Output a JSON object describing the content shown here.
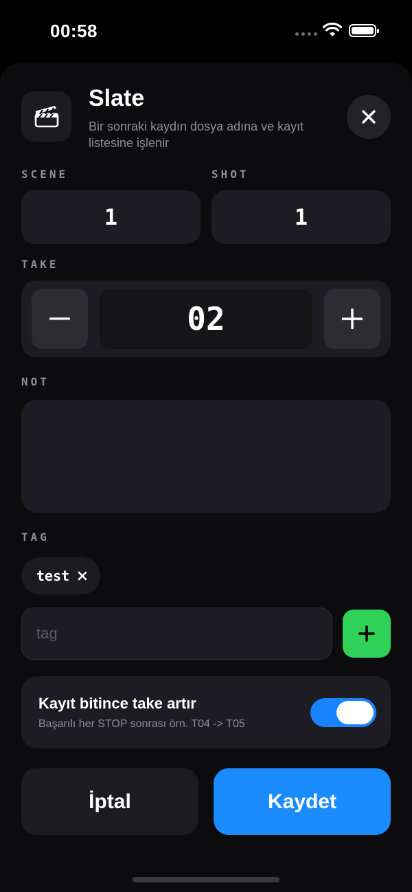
{
  "status_bar": {
    "time": "00:58"
  },
  "header": {
    "title": "Slate",
    "subtitle": "Bir sonraki kaydın dosya adına ve kayıt listesine işlenir"
  },
  "scene": {
    "label": "SCENE",
    "value": "1"
  },
  "shot": {
    "label": "SHOT",
    "value": "1"
  },
  "take": {
    "label": "TAKE",
    "value": "02"
  },
  "note": {
    "label": "NOT",
    "value": ""
  },
  "tags": {
    "label": "TAG",
    "items": [
      {
        "text": "test"
      }
    ],
    "input_placeholder": "tag",
    "input_value": ""
  },
  "auto_increment": {
    "title": "Kayıt bitince take artır",
    "subtitle": "Başarılı her STOP sonrası örn. T04 -> T05",
    "enabled": true
  },
  "actions": {
    "cancel_label": "İptal",
    "save_label": "Kaydet"
  },
  "colors": {
    "accent": "#1a8cff",
    "add": "#30d158",
    "background": "#000000"
  }
}
